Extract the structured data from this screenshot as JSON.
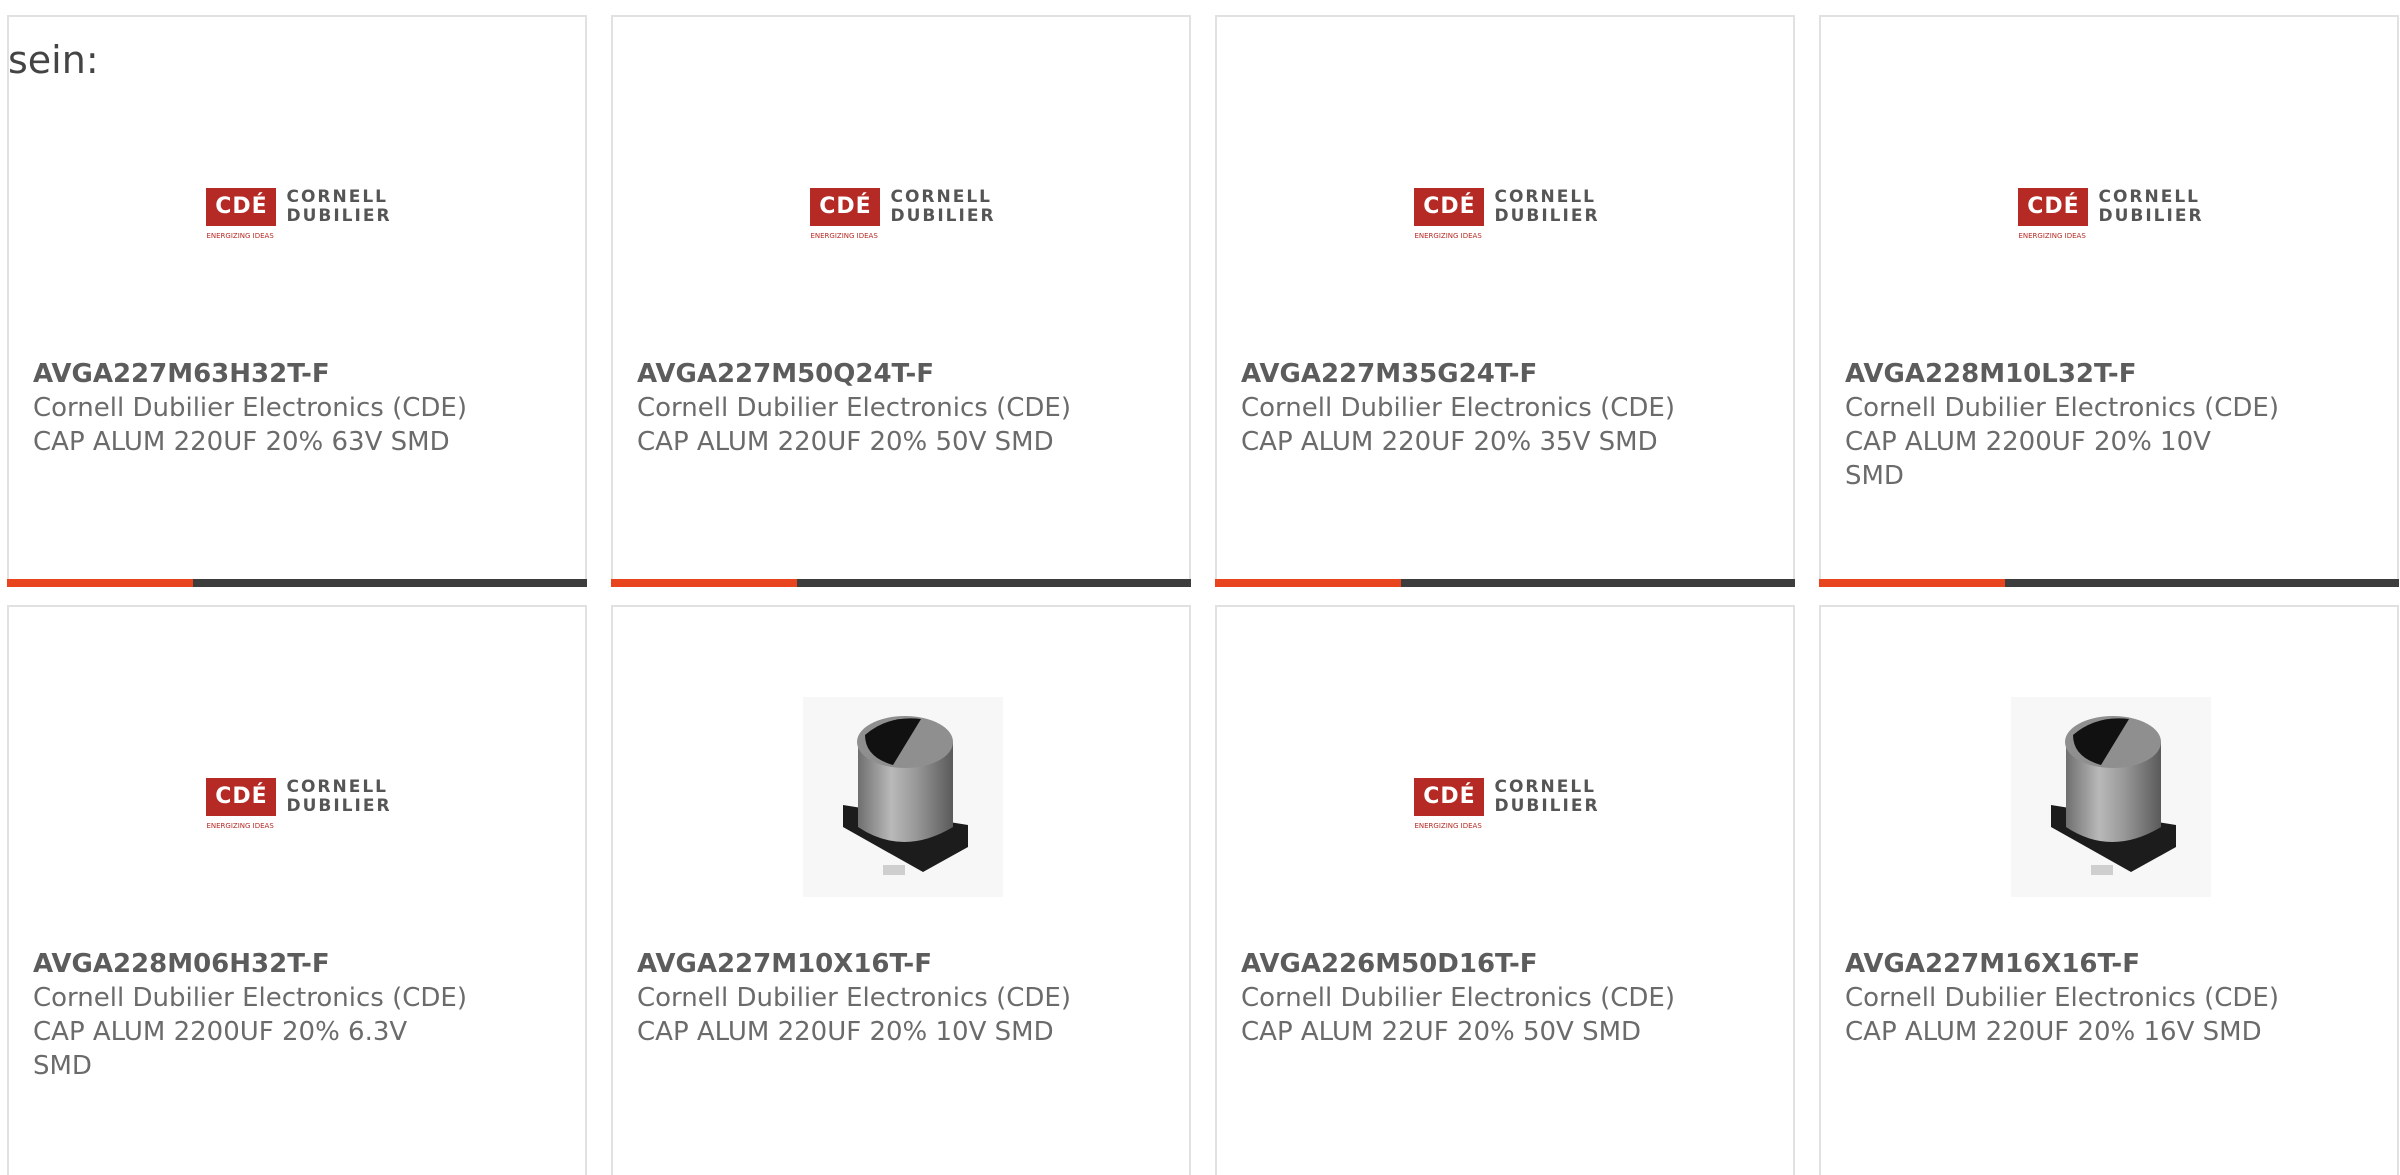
{
  "intro_text": "sein:",
  "logo": {
    "badge": "CDÉ",
    "line1": "CORNELL",
    "line2": "DUBILIER",
    "tagline": "ENERGIZING IDEAS",
    "brand_color": "#b52a25"
  },
  "colors": {
    "accent": "#e8441d",
    "bar": "#3d3d3d",
    "card_border": "#e1e1e1",
    "text": "#6b6b6b"
  },
  "products": [
    {
      "part_number": "AVGA227M63H32T-F",
      "manufacturer": "Cornell Dubilier Electronics (CDE)",
      "description": "CAP ALUM 220UF 20% 63V SMD",
      "image": "cde-logo"
    },
    {
      "part_number": "AVGA227M50Q24T-F",
      "manufacturer": "Cornell Dubilier Electronics (CDE)",
      "description": "CAP ALUM 220UF 20% 50V SMD",
      "image": "cde-logo"
    },
    {
      "part_number": "AVGA227M35G24T-F",
      "manufacturer": "Cornell Dubilier Electronics (CDE)",
      "description": "CAP ALUM 220UF 20% 35V SMD",
      "image": "cde-logo"
    },
    {
      "part_number": "AVGA228M10L32T-F",
      "manufacturer": "Cornell Dubilier Electronics (CDE)",
      "description": "CAP ALUM 2200UF 20% 10V SMD",
      "image": "cde-logo"
    },
    {
      "part_number": "AVGA228M06H32T-F",
      "manufacturer": "Cornell Dubilier Electronics (CDE)",
      "description": "CAP ALUM 2200UF 20% 6.3V SMD",
      "image": "cde-logo"
    },
    {
      "part_number": "AVGA227M10X16T-F",
      "manufacturer": "Cornell Dubilier Electronics (CDE)",
      "description": "CAP ALUM 220UF 20% 10V SMD",
      "image": "capacitor-photo"
    },
    {
      "part_number": "AVGA226M50D16T-F",
      "manufacturer": "Cornell Dubilier Electronics (CDE)",
      "description": "CAP ALUM 22UF 20% 50V SMD",
      "image": "cde-logo"
    },
    {
      "part_number": "AVGA227M16X16T-F",
      "manufacturer": "Cornell Dubilier Electronics (CDE)",
      "description": "CAP ALUM 220UF 20% 16V SMD",
      "image": "capacitor-photo"
    }
  ],
  "progress_fraction": 0.32
}
